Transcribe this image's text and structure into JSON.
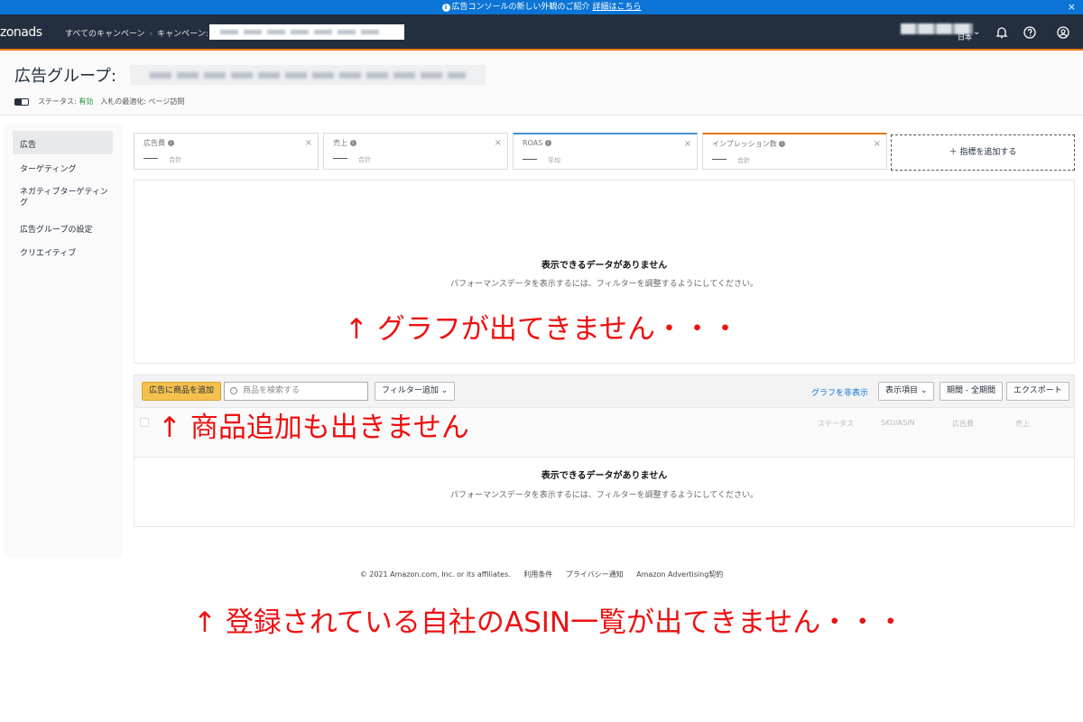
{
  "banner": {
    "text": "広告コンソールの新しい外観のご紹介",
    "link": "詳細はこちら",
    "close": "×"
  },
  "topbar": {
    "logo_bold": "zonads",
    "crumb_all": "すべてのキャンペーン",
    "crumb_campaign": "キャンペーン:",
    "lang": "日本",
    "chevron": "⌄"
  },
  "title": {
    "label": "広告グループ:",
    "status_label": "ステータス:",
    "status_value": "有効",
    "bid_label": "入札の最適化:",
    "bid_value": "ページ訪問"
  },
  "sidebar": {
    "items": [
      "広告",
      "ターゲティング",
      "ネガティブターゲティング",
      "広告グループの設定",
      "クリエイティブ"
    ]
  },
  "metrics": [
    {
      "name": "広告費",
      "agg": "合計",
      "color": "#dcdcdc"
    },
    {
      "name": "売上",
      "agg": "合計",
      "color": "#dcdcdc"
    },
    {
      "name": "ROAS",
      "agg": "平均",
      "color": "#4a90c8"
    },
    {
      "name": "インプレッション数",
      "agg": "合計",
      "color": "#e47911"
    }
  ],
  "add_metric": "＋ 指標を追加する",
  "chart": {
    "no_data_title": "表示できるデータがありません",
    "no_data_sub": "パフォーマンスデータを表示するには、フィルターを調整するようにしてください。"
  },
  "annotations": {
    "graph": "↑ グラフが出てきません・・・",
    "product": "↑ 商品追加も出きません",
    "asin": "↑ 登録されている自社のASIN一覧が出てきません・・・"
  },
  "toolbar": {
    "add_product": "広告に商品を追加",
    "search_placeholder": "商品を検索する",
    "filter": "フィルター追加 ⌄",
    "hide_graph": "グラフを非表示",
    "columns": "表示項目 ⌄",
    "period": "期間 - 全期間",
    "export": "エクスポート"
  },
  "table": {
    "headers": [
      "ステータス",
      "SKU/ASIN",
      "広告費",
      "売上"
    ],
    "no_data_title": "表示できるデータがありません",
    "no_data_sub": "パフォーマンスデータを表示するには、フィルターを調整するようにしてください。"
  },
  "footer": {
    "copyright": "© 2021 Amazon.com, Inc. or its affiliates.",
    "terms": "利用条件",
    "privacy": "プライバシー通知",
    "agreement": "Amazon Advertising契約"
  }
}
